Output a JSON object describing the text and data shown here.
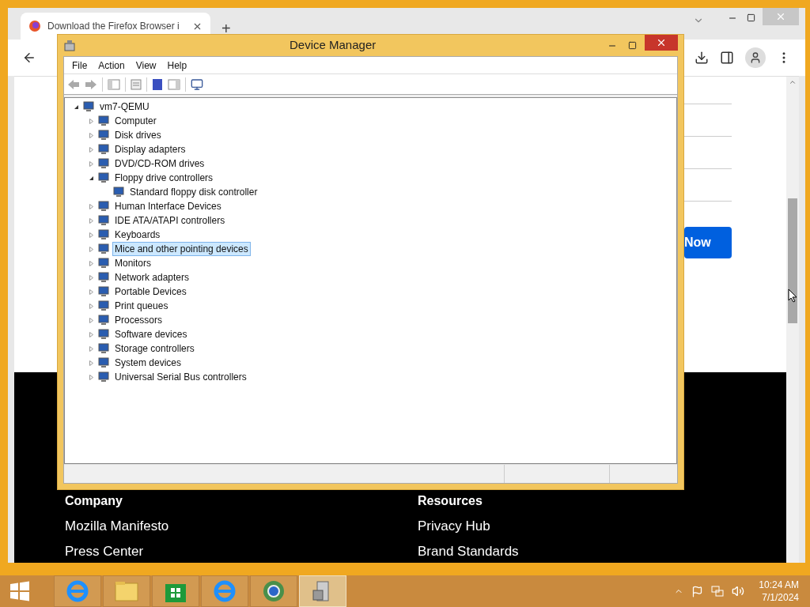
{
  "browser": {
    "tab_title": "Download the Firefox Browser i",
    "new_tab": "+",
    "page_button": "Now",
    "footer": [
      {
        "heading": "Company",
        "links": [
          "Mozilla Manifesto",
          "Press Center"
        ]
      },
      {
        "heading": "Resources",
        "links": [
          "Privacy Hub",
          "Brand Standards"
        ]
      }
    ]
  },
  "device_manager": {
    "title": "Device Manager",
    "menu": [
      "File",
      "Action",
      "View",
      "Help"
    ],
    "tree": {
      "label": "vm7-QEMU",
      "expanded": true,
      "selected": false,
      "children": [
        {
          "label": "Computer",
          "expanded": false,
          "selected": false
        },
        {
          "label": "Disk drives",
          "expanded": false,
          "selected": false
        },
        {
          "label": "Display adapters",
          "expanded": false,
          "selected": false
        },
        {
          "label": "DVD/CD-ROM drives",
          "expanded": false,
          "selected": false
        },
        {
          "label": "Floppy drive controllers",
          "expanded": true,
          "selected": false,
          "children": [
            {
              "label": "Standard floppy disk controller",
              "selected": false
            }
          ]
        },
        {
          "label": "Human Interface Devices",
          "expanded": false,
          "selected": false
        },
        {
          "label": "IDE ATA/ATAPI controllers",
          "expanded": false,
          "selected": false
        },
        {
          "label": "Keyboards",
          "expanded": false,
          "selected": false
        },
        {
          "label": "Mice and other pointing devices",
          "expanded": false,
          "selected": true
        },
        {
          "label": "Monitors",
          "expanded": false,
          "selected": false
        },
        {
          "label": "Network adapters",
          "expanded": false,
          "selected": false
        },
        {
          "label": "Portable Devices",
          "expanded": false,
          "selected": false
        },
        {
          "label": "Print queues",
          "expanded": false,
          "selected": false
        },
        {
          "label": "Processors",
          "expanded": false,
          "selected": false
        },
        {
          "label": "Software devices",
          "expanded": false,
          "selected": false
        },
        {
          "label": "Storage controllers",
          "expanded": false,
          "selected": false
        },
        {
          "label": "System devices",
          "expanded": false,
          "selected": false
        },
        {
          "label": "Universal Serial Bus controllers",
          "expanded": false,
          "selected": false
        }
      ]
    }
  },
  "taskbar": {
    "apps": [
      {
        "kind": "browser",
        "selected": false
      },
      {
        "kind": "folder",
        "selected": false
      },
      {
        "kind": "store",
        "selected": false
      },
      {
        "kind": "browser",
        "selected": false
      },
      {
        "kind": "globe",
        "selected": false
      },
      {
        "kind": "devices",
        "selected": true
      }
    ],
    "time": "10:24 AM",
    "date": "7/1/2024"
  }
}
